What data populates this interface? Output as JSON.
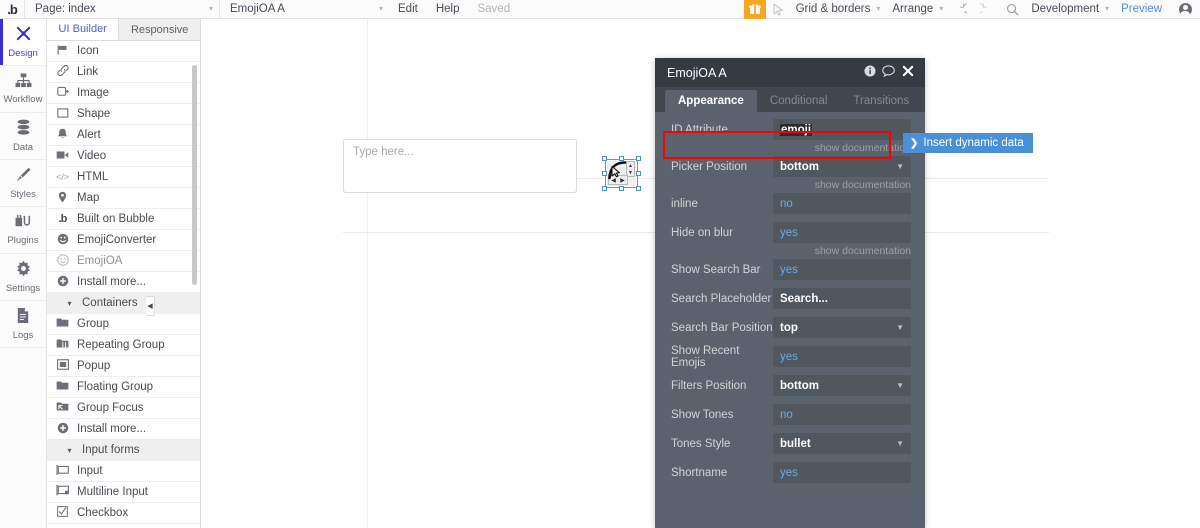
{
  "topbar": {
    "logo": "bubble-logo",
    "page_selector": {
      "label": "Page: index",
      "caret": "▾"
    },
    "element_selector": {
      "label": "EmojiOA A",
      "caret": "▾"
    },
    "edit_label": "Edit",
    "help_label": "Help",
    "saved_label": "Saved",
    "gift_icon": "gift-icon",
    "pointer_icon": "pointer-icon",
    "grid_borders": {
      "label": "Grid & borders",
      "caret": "▾"
    },
    "arrange": {
      "label": "Arrange",
      "caret": "▾"
    },
    "undo_icon": "undo-icon",
    "redo_icon": "redo-icon",
    "search_icon": "search-icon",
    "development": {
      "label": "Development",
      "caret": "▾"
    },
    "preview_label": "Preview",
    "avatar": "user-avatar"
  },
  "rail": {
    "items": [
      {
        "label": "Design",
        "icon": "design-icon",
        "glyph": "✖",
        "active": true
      },
      {
        "label": "Workflow",
        "icon": "workflow-icon",
        "glyph": "⑂",
        "active": false
      },
      {
        "label": "Data",
        "icon": "data-icon",
        "glyph": "≡",
        "active": false
      },
      {
        "label": "Styles",
        "icon": "styles-brush-icon",
        "glyph": "✐",
        "active": false
      },
      {
        "label": "Plugins",
        "icon": "plugins-icon",
        "glyph": "⚙",
        "active": false
      },
      {
        "label": "Settings",
        "icon": "settings-gear-icon",
        "glyph": "⚙",
        "active": false
      },
      {
        "label": "Logs",
        "icon": "logs-document-icon",
        "glyph": "☰",
        "active": false
      }
    ]
  },
  "palette": {
    "tabs": [
      {
        "label": "UI Builder",
        "active": true
      },
      {
        "label": "Responsive",
        "active": false
      }
    ],
    "items": [
      {
        "label": "Icon",
        "icon": "flag-icon",
        "glyph": "⚑",
        "type": "item"
      },
      {
        "label": "Link",
        "icon": "link-icon",
        "glyph": "⚭",
        "type": "item"
      },
      {
        "label": "Image",
        "icon": "image-icon",
        "glyph": "❐",
        "type": "item"
      },
      {
        "label": "Shape",
        "icon": "shape-icon",
        "glyph": "▭",
        "type": "item"
      },
      {
        "label": "Alert",
        "icon": "alert-bell-icon",
        "glyph": "⚑",
        "type": "item"
      },
      {
        "label": "Video",
        "icon": "video-icon",
        "glyph": "▶",
        "type": "item"
      },
      {
        "label": "HTML",
        "icon": "html-code-icon",
        "glyph": "</>",
        "type": "item"
      },
      {
        "label": "Map",
        "icon": "map-pin-icon",
        "glyph": "⚑",
        "type": "item"
      },
      {
        "label": "Built on Bubble",
        "icon": "bubble-icon",
        "glyph": ".b",
        "type": "item"
      },
      {
        "label": "EmojiConverter",
        "icon": "emoji-filled-icon",
        "glyph": "☻",
        "type": "item"
      },
      {
        "label": "EmojiOA",
        "icon": "emoji-outline-icon",
        "glyph": "☺",
        "type": "item"
      },
      {
        "label": "Install more...",
        "icon": "plus-circle-icon",
        "glyph": "⊕",
        "type": "item"
      },
      {
        "label": "Containers",
        "icon": "chevron-down-icon",
        "glyph": "▾",
        "type": "group"
      },
      {
        "label": "Group",
        "icon": "folder-icon",
        "glyph": "▰",
        "type": "item"
      },
      {
        "label": "Repeating Group",
        "icon": "repeating-folder-icon",
        "glyph": "▰",
        "type": "item"
      },
      {
        "label": "Popup",
        "icon": "popup-icon",
        "glyph": "▣",
        "type": "item"
      },
      {
        "label": "Floating Group",
        "icon": "floating-group-icon",
        "glyph": "▰",
        "type": "item"
      },
      {
        "label": "Group Focus",
        "icon": "group-focus-icon",
        "glyph": "▤",
        "type": "item"
      },
      {
        "label": "Install more...",
        "icon": "plus-circle-icon",
        "glyph": "⊕",
        "type": "item"
      },
      {
        "label": "Input forms",
        "icon": "chevron-down-icon",
        "glyph": "▾",
        "type": "group"
      },
      {
        "label": "Input",
        "icon": "input-icon",
        "glyph": "▭",
        "type": "item"
      },
      {
        "label": "Multiline Input",
        "icon": "multiline-input-icon",
        "glyph": "▤",
        "type": "item"
      },
      {
        "label": "Checkbox",
        "icon": "checkbox-icon",
        "glyph": "☑",
        "type": "item"
      }
    ],
    "collapse_icon": "collapse-panel-icon",
    "collapse_glyph": "◀"
  },
  "canvas": {
    "input_placeholder": "Type here...",
    "selected_element": "emojioa-element",
    "cursor_icon": "resize-cursor-icon"
  },
  "property_editor": {
    "title": "EmojiOA A",
    "info_icon": "info-icon",
    "comment_icon": "comment-icon",
    "close_icon": "close-icon",
    "tabs": [
      {
        "label": "Appearance",
        "active": true
      },
      {
        "label": "Conditional",
        "active": false
      },
      {
        "label": "Transitions",
        "active": false
      }
    ],
    "doc_link": "show documentation",
    "rows": [
      {
        "label": "ID Attribute",
        "value": "emoji",
        "kind": "text-selected",
        "doc": true
      },
      {
        "label": "Picker Position",
        "value": "bottom",
        "kind": "dropdown",
        "doc": true
      },
      {
        "label": "inline",
        "value": "no",
        "kind": "boolean",
        "doc": false
      },
      {
        "label": "Hide on blur",
        "value": "yes",
        "kind": "boolean",
        "doc": true
      },
      {
        "label": "Show Search Bar",
        "value": "yes",
        "kind": "boolean",
        "doc": false
      },
      {
        "label": "Search Placeholder",
        "value": "Search...",
        "kind": "text",
        "doc": false
      },
      {
        "label": "Search Bar Position",
        "value": "top",
        "kind": "dropdown",
        "doc": false
      },
      {
        "label": "Show Recent Emojis",
        "value": "yes",
        "kind": "boolean",
        "doc": false
      },
      {
        "label": "Filters Position",
        "value": "bottom",
        "kind": "dropdown",
        "doc": false
      },
      {
        "label": "Show Tones",
        "value": "no",
        "kind": "boolean",
        "doc": false
      },
      {
        "label": "Tones Style",
        "value": "bullet",
        "kind": "dropdown",
        "doc": false
      },
      {
        "label": "Shortname",
        "value": "yes",
        "kind": "boolean",
        "doc": false
      }
    ],
    "highlight_color": "#ff0000",
    "dynamic_data_button": {
      "label": "Insert dynamic data",
      "chevron": "❯"
    }
  }
}
